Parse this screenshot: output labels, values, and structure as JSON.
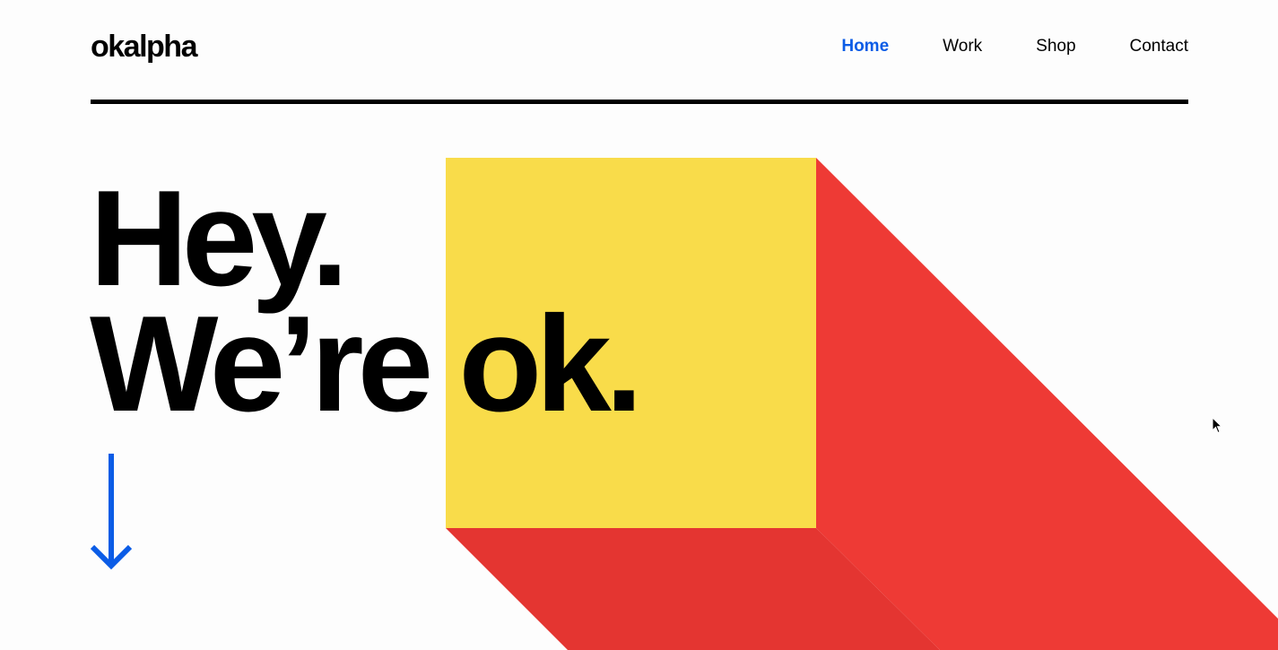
{
  "brand": {
    "logo_text": "okalpha"
  },
  "nav": {
    "items": [
      {
        "label": "Home",
        "active": true
      },
      {
        "label": "Work",
        "active": false
      },
      {
        "label": "Shop",
        "active": false
      },
      {
        "label": "Contact",
        "active": false
      }
    ]
  },
  "hero": {
    "line1": "Hey.",
    "line2": "We’re ok."
  },
  "colors": {
    "accent": "#0b5ce6",
    "yellow": "#f9dc4a",
    "red": "#ee3a35",
    "red_dark": "#e43531",
    "text": "#000000",
    "background": "#fdfdfd"
  },
  "icons": {
    "scroll": "arrow-down-icon",
    "pointer": "mouse-cursor-icon"
  }
}
